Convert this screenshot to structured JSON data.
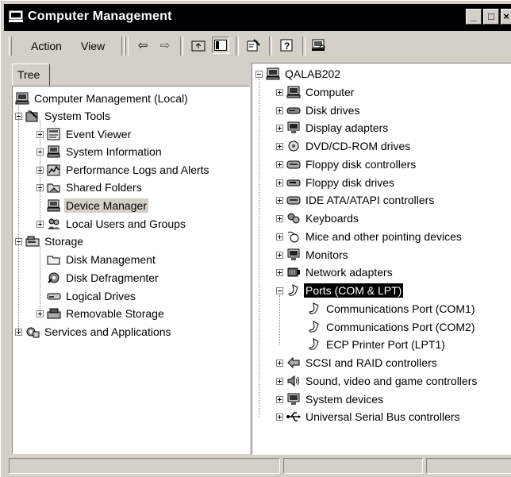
{
  "window": {
    "title": "Computer Management"
  },
  "menubar": {
    "action": "Action",
    "view": "View"
  },
  "toolbar": {
    "back_glyph": "⇦",
    "forward_glyph": "⇨"
  },
  "left_pane": {
    "tab_label": "Tree",
    "tree": [
      {
        "label": "Computer Management (Local)",
        "icon": "computer-management-icon"
      },
      {
        "label": "System Tools",
        "icon": "system-tools-icon"
      },
      {
        "label": "Event Viewer",
        "icon": "event-viewer-icon"
      },
      {
        "label": "System Information",
        "icon": "system-information-icon"
      },
      {
        "label": "Performance Logs and Alerts",
        "icon": "performance-logs-icon"
      },
      {
        "label": "Shared Folders",
        "icon": "shared-folders-icon"
      },
      {
        "label": "Device Manager",
        "icon": "device-manager-icon",
        "highlighted": true
      },
      {
        "label": "Local Users and Groups",
        "icon": "local-users-icon"
      },
      {
        "label": "Storage",
        "icon": "storage-icon"
      },
      {
        "label": "Disk Management",
        "icon": "disk-management-icon"
      },
      {
        "label": "Disk Defragmenter",
        "icon": "disk-defragmenter-icon"
      },
      {
        "label": "Logical Drives",
        "icon": "logical-drives-icon"
      },
      {
        "label": "Removable Storage",
        "icon": "removable-storage-icon"
      },
      {
        "label": "Services and Applications",
        "icon": "services-applications-icon"
      }
    ]
  },
  "right_pane": {
    "tree": [
      {
        "label": "QALAB202",
        "icon": "computer-icon"
      },
      {
        "label": "Computer",
        "icon": "computer-icon"
      },
      {
        "label": "Disk drives",
        "icon": "disk-drive-icon"
      },
      {
        "label": "Display adapters",
        "icon": "monitor-icon"
      },
      {
        "label": "DVD/CD-ROM drives",
        "icon": "cd-drive-icon"
      },
      {
        "label": "Floppy disk controllers",
        "icon": "controller-icon"
      },
      {
        "label": "Floppy disk drives",
        "icon": "floppy-drive-icon"
      },
      {
        "label": "IDE ATA/ATAPI controllers",
        "icon": "controller-icon"
      },
      {
        "label": "Keyboards",
        "icon": "keyboard-icon"
      },
      {
        "label": "Mice and other pointing devices",
        "icon": "mouse-icon"
      },
      {
        "label": "Monitors",
        "icon": "monitor-icon"
      },
      {
        "label": "Network adapters",
        "icon": "network-adapter-icon"
      },
      {
        "label": "Ports (COM & LPT)",
        "icon": "port-icon",
        "selected": true
      },
      {
        "label": "Communications Port (COM1)",
        "icon": "port-icon"
      },
      {
        "label": "Communications Port (COM2)",
        "icon": "port-icon"
      },
      {
        "label": "ECP Printer Port (LPT1)",
        "icon": "port-icon"
      },
      {
        "label": "SCSI and RAID controllers",
        "icon": "scsi-icon"
      },
      {
        "label": "Sound, video and game controllers",
        "icon": "sound-icon"
      },
      {
        "label": "System devices",
        "icon": "system-device-icon"
      },
      {
        "label": "Universal Serial Bus controllers",
        "icon": "usb-icon"
      }
    ]
  },
  "statusbar": {
    "panels": [
      "",
      "",
      ""
    ]
  }
}
